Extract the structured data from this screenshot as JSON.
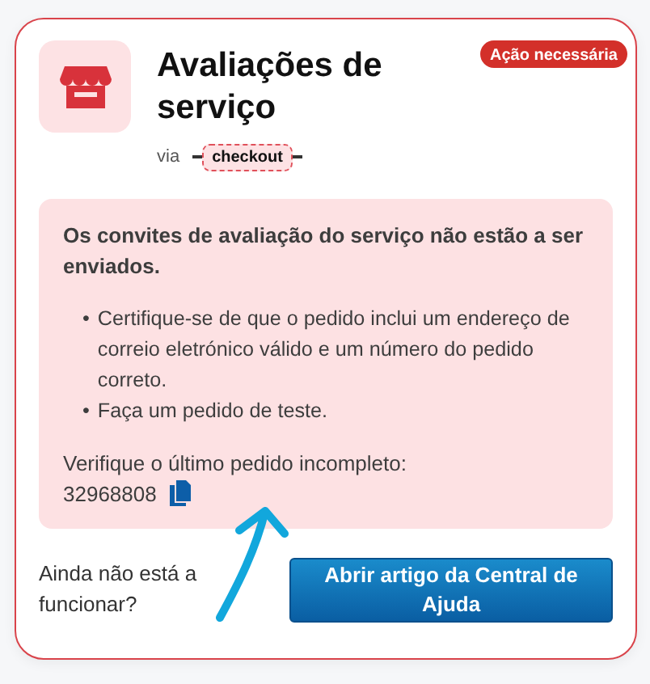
{
  "card": {
    "title": "Avaliações de serviço",
    "badge": "Ação necessária",
    "via_label": "via",
    "source_tag": "checkout"
  },
  "alert": {
    "heading": "Os convites de avaliação do serviço não estão a ser enviados.",
    "bullets": [
      {
        "marker": "•",
        "text": "Certifique-se de que o pedido inclui um endereço de correio eletrónico válido e um número do pedido correto."
      },
      {
        "marker": "•",
        "text": "Faça um pedido de teste."
      }
    ],
    "check_label": "Verifique o último pedido incompleto:",
    "order_number": "32968808"
  },
  "footer": {
    "question": "Ainda não está a funcionar?",
    "button": "Abrir artigo da Central de Ajuda"
  }
}
